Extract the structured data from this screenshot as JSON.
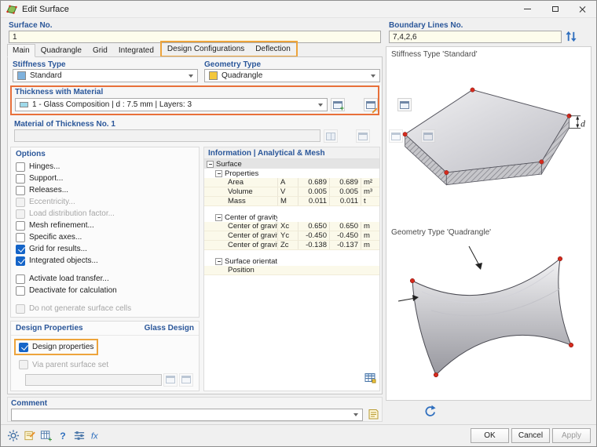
{
  "window": {
    "title": "Edit Surface"
  },
  "header": {
    "surface_no_label": "Surface No.",
    "surface_no_value": "1",
    "boundary_label": "Boundary Lines No.",
    "boundary_value": "7,4,2,6"
  },
  "tabs": [
    "Main",
    "Quadrangle",
    "Grid",
    "Integrated",
    "Design Configurations",
    "Deflection"
  ],
  "fields": {
    "stiffness_label": "Stiffness Type",
    "stiffness_value": "Standard",
    "geometry_label": "Geometry Type",
    "geometry_value": "Quadrangle",
    "thickness_label": "Thickness with Material",
    "thickness_value": "1 - Glass Composition | d : 7.5 mm | Layers: 3",
    "material_label": "Material of Thickness No. 1",
    "material_value": ""
  },
  "options": {
    "label": "Options",
    "items": [
      {
        "label": "Hinges...",
        "state": "unchecked"
      },
      {
        "label": "Support...",
        "state": "unchecked"
      },
      {
        "label": "Releases...",
        "state": "unchecked"
      },
      {
        "label": "Eccentricity...",
        "state": "disabled"
      },
      {
        "label": "Load distribution factor...",
        "state": "disabled"
      },
      {
        "label": "Mesh refinement...",
        "state": "unchecked"
      },
      {
        "label": "Specific axes...",
        "state": "unchecked"
      },
      {
        "label": "Grid for results...",
        "state": "checked"
      },
      {
        "label": "Integrated objects...",
        "state": "checked"
      },
      {
        "label": "Activate load transfer...",
        "state": "unchecked"
      },
      {
        "label": "Deactivate for calculation",
        "state": "unchecked"
      },
      {
        "label": "Do not generate surface cells",
        "state": "disabled"
      }
    ]
  },
  "info": {
    "title": "Information | Analytical & Mesh",
    "root": "Surface",
    "groups": [
      {
        "name": "Properties",
        "rows": [
          {
            "label": "Area",
            "symbol": "A",
            "v1": "0.689",
            "v2": "0.689",
            "unit": "m²"
          },
          {
            "label": "Volume",
            "symbol": "V",
            "v1": "0.005",
            "v2": "0.005",
            "unit": "m³"
          },
          {
            "label": "Mass",
            "symbol": "M",
            "v1": "0.011",
            "v2": "0.011",
            "unit": "t"
          }
        ]
      },
      {
        "name": "Center of gravity",
        "rows": [
          {
            "label": "Center of gravity",
            "symbol": "Xc",
            "v1": "0.650",
            "v2": "0.650",
            "unit": "m"
          },
          {
            "label": "Center of gravity",
            "symbol": "Yc",
            "v1": "-0.450",
            "v2": "-0.450",
            "unit": "m"
          },
          {
            "label": "Center of gravity",
            "symbol": "Zc",
            "v1": "-0.138",
            "v2": "-0.137",
            "unit": "m"
          }
        ]
      },
      {
        "name": "Surface orientation",
        "rows": [
          {
            "label": "Position",
            "symbol": "",
            "v1": "",
            "v2": "",
            "unit": ""
          }
        ]
      }
    ]
  },
  "design": {
    "label": "Design Properties",
    "type_label": "Glass Design",
    "design_properties_label": "Design properties",
    "via_parent_label": "Via parent surface set",
    "via_parent_value": ""
  },
  "comment": {
    "label": "Comment",
    "value": ""
  },
  "preview": {
    "stiffness_caption": "Stiffness Type 'Standard'",
    "geometry_caption": "Geometry Type 'Quadrangle'",
    "dimension_label": "d"
  },
  "buttons": {
    "ok": "OK",
    "cancel": "Cancel",
    "apply": "Apply"
  },
  "icons": {
    "plus": "+",
    "help": "?",
    "formula": "fx"
  },
  "colors": {
    "label_blue": "#2b579a",
    "checkbox_blue": "#1464c8",
    "highlight_gold": "#eda43c",
    "highlight_orange": "#e8703a",
    "field_yellow": "#fdfcec",
    "node_red": "#d42b1e",
    "icon_blue": "#2f6fbe"
  }
}
